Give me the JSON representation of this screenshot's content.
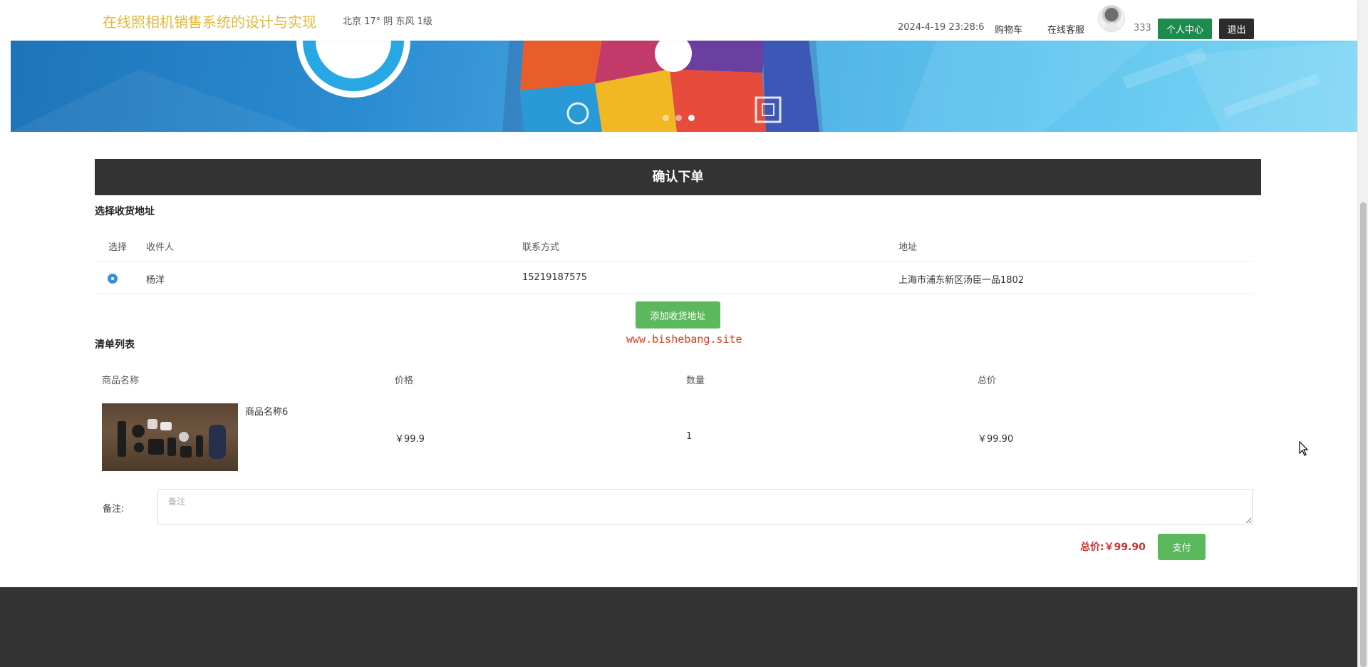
{
  "header": {
    "site_title": "在线照相机销售系统的设计与实现",
    "weather": "北京  17°  阴  东风  1级",
    "datetime": "2024-4-19 23:28:6",
    "nav_cart": "购物车",
    "nav_service": "在线客服",
    "username": "333",
    "personal_center": "个人中心",
    "logout": "退出"
  },
  "order": {
    "bar_title": "确认下单",
    "address_section_title": "选择收货地址",
    "address_columns": [
      "选择",
      "收件人",
      "联系方式",
      "地址"
    ],
    "address_rows": [
      {
        "selected": true,
        "recipient": "杨洋",
        "phone": "15219187575",
        "address": "上海市浦东新区汤臣一品1802"
      }
    ],
    "add_address_label": "添加收货地址",
    "watermark": "www.bishebang.site",
    "list_section_title": "清单列表",
    "item_columns": [
      "商品名称",
      "价格",
      "数量",
      "总价"
    ],
    "items": [
      {
        "name": "商品名称6",
        "price": "￥99.9",
        "quantity": "1",
        "total": "￥99.90"
      }
    ],
    "remark_label": "备注:",
    "remark_placeholder": "备注",
    "total_label": "总价:￥99.90",
    "pay_label": "支付"
  },
  "colors": {
    "site_title": "#e0b93c",
    "order_bar": "#333333",
    "green_button": "#5cb85c",
    "personal_button": "#1d8a4e",
    "total_red": "#d0312d",
    "footer": "#333333"
  }
}
